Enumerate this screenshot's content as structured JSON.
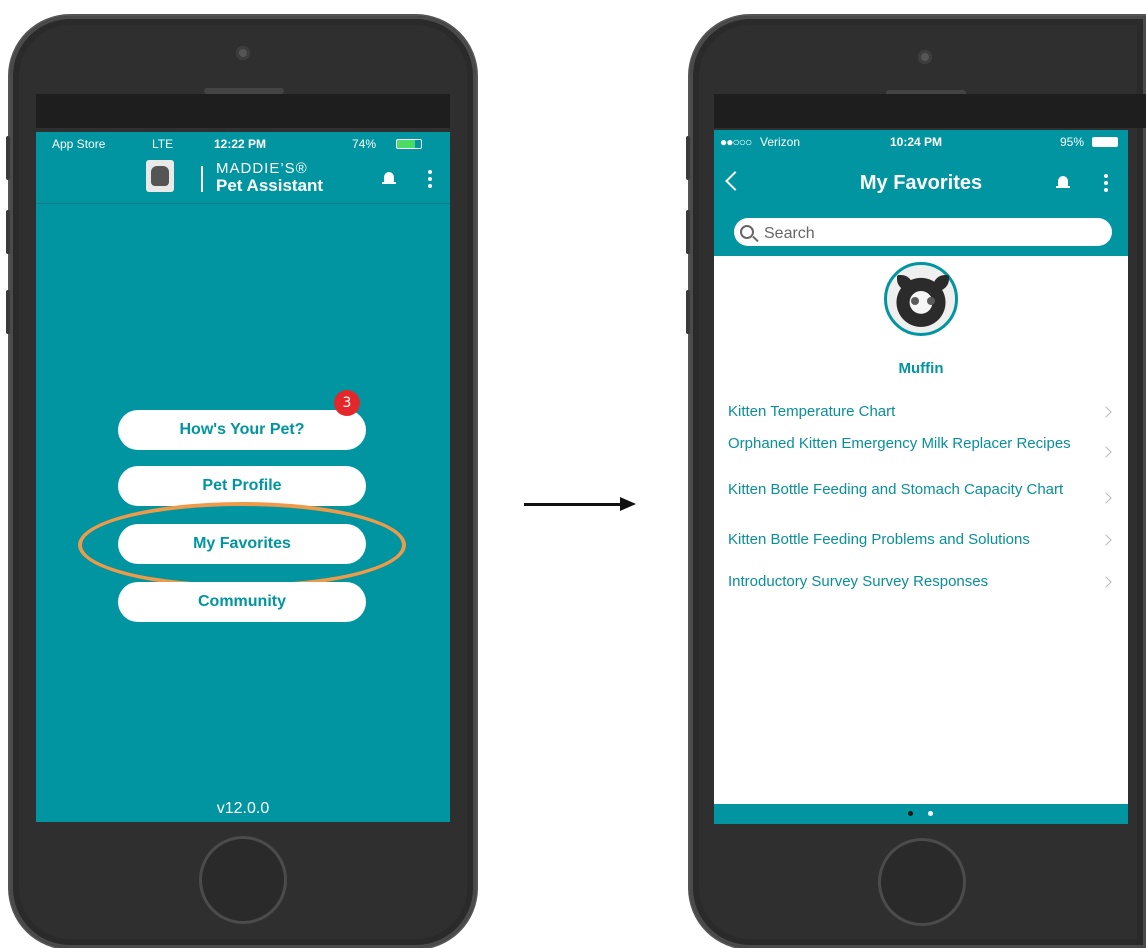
{
  "left_phone": {
    "status": {
      "carrier": "App Store",
      "network": "LTE",
      "time": "12:22 PM",
      "battery": "74%"
    },
    "header": {
      "brand_line1": "MADDIE’S®",
      "brand_line2": "Pet Assistant"
    },
    "menu": [
      {
        "label": "How's Your Pet?",
        "badge": "3"
      },
      {
        "label": "Pet Profile"
      },
      {
        "label": "My Favorites",
        "highlighted": true
      },
      {
        "label": "Community"
      }
    ],
    "version": "v12.0.0"
  },
  "right_phone": {
    "status": {
      "carrier": "Verizon",
      "time": "10:24 PM",
      "battery": "95%"
    },
    "header": {
      "title": "My Favorites"
    },
    "search": {
      "placeholder": "Search"
    },
    "pet": {
      "name": "Muffin"
    },
    "favorites": [
      "Kitten Temperature Chart",
      "Orphaned Kitten Emergency Milk Replacer Recipes",
      "Kitten Bottle Feeding and Stomach Capacity Chart",
      "Kitten Bottle Feeding Problems and Solutions",
      "Introductory Survey Survey Responses"
    ],
    "pager": {
      "pages": 2,
      "current": 1
    }
  },
  "colors": {
    "teal": "#0095a0",
    "highlight_ring": "#ef9a48",
    "badge": "#e3272a"
  }
}
